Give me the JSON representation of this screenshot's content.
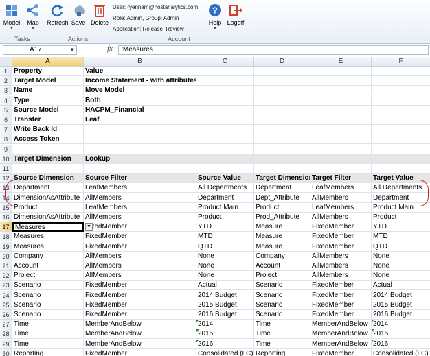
{
  "ribbon": {
    "groups": [
      {
        "label": "Tasks",
        "buttons": [
          {
            "label": "Model",
            "icon": "model-icon"
          },
          {
            "label": "Map",
            "icon": "map-icon"
          }
        ]
      },
      {
        "label": "Actions",
        "buttons": [
          {
            "label": "Refresh",
            "icon": "refresh-icon"
          },
          {
            "label": "Save",
            "icon": "save-icon"
          },
          {
            "label": "Delete",
            "icon": "delete-icon"
          }
        ]
      },
      {
        "label": "Account",
        "buttons": [
          {
            "label": "Help",
            "icon": "help-icon"
          },
          {
            "label": "Logoff",
            "icon": "logoff-icon"
          }
        ]
      }
    ],
    "user": "User: ryennam@hostanalytics.com",
    "role": "Role: Admin, Group: Admin",
    "application": "Application: Release_Review"
  },
  "formula_bar": {
    "name_box": "A17",
    "fx": "fx",
    "content": "'Measures"
  },
  "columns": [
    "A",
    "B",
    "C",
    "D",
    "E",
    "F"
  ],
  "rows": [
    {
      "num": "1",
      "cells": [
        "Property",
        "Value",
        "",
        "",
        "",
        ""
      ],
      "bold": true
    },
    {
      "num": "2",
      "cells": [
        "Target Model",
        "Income Statement - with attributes",
        "",
        "",
        "",
        ""
      ],
      "bold": true
    },
    {
      "num": "3",
      "cells": [
        "Name",
        "Move Model",
        "",
        "",
        "",
        ""
      ],
      "bold": true
    },
    {
      "num": "4",
      "cells": [
        "Type",
        "Both",
        "",
        "",
        "",
        ""
      ],
      "bold": true
    },
    {
      "num": "5",
      "cells": [
        "Source Model",
        "HACPM_Financial",
        "",
        "",
        "",
        ""
      ],
      "bold": true
    },
    {
      "num": "6",
      "cells": [
        "Transfer",
        "Leaf",
        "",
        "",
        "",
        ""
      ],
      "bold": true
    },
    {
      "num": "7",
      "cells": [
        "Write Back Id",
        "",
        "",
        "",
        "",
        ""
      ],
      "bold": true
    },
    {
      "num": "8",
      "cells": [
        "Access Token",
        "",
        "",
        "",
        "",
        ""
      ],
      "bold": true
    },
    {
      "num": "9",
      "cells": [
        "",
        "",
        "",
        "",
        "",
        ""
      ]
    },
    {
      "num": "10",
      "cells": [
        "Target Dimension",
        "Lookup",
        "",
        "",
        "",
        ""
      ],
      "bold": true,
      "shade": true
    },
    {
      "num": "11",
      "cells": [
        "",
        "",
        "",
        "",
        "",
        ""
      ]
    },
    {
      "num": "12",
      "cells": [
        "Source Dimension",
        "Source Filter",
        "Source Value",
        "Target Dimension",
        "Target Filter",
        "Target Value"
      ],
      "bold": true,
      "shade": true
    },
    {
      "num": "13",
      "cells": [
        "Department",
        "LeafMembers",
        "All Departments",
        "Department",
        "LeafMembers",
        "All Departments"
      ]
    },
    {
      "num": "14",
      "cells": [
        "DimensionAsAttribute",
        "AllMembers",
        "Department",
        "Dept_Attribute",
        "AllMembers",
        "Department"
      ]
    },
    {
      "num": "15",
      "cells": [
        "Product",
        "LeafMembers",
        "Product Main",
        "Product",
        "LeafMembers",
        "Product Main"
      ]
    },
    {
      "num": "16",
      "cells": [
        "DimensionAsAttribute",
        "AllMembers",
        "Product",
        "Prod_Attribute",
        "AllMembers",
        "Product"
      ]
    },
    {
      "num": "17",
      "cells": [
        "Measures",
        "FixedMember",
        "YTD",
        "Measure",
        "FixedMember",
        "YTD"
      ]
    },
    {
      "num": "18",
      "cells": [
        "Measures",
        "FixedMember",
        "MTD",
        "Measure",
        "FixedMember",
        "MTD"
      ]
    },
    {
      "num": "19",
      "cells": [
        "Measures",
        "FixedMember",
        "QTD",
        "Measure",
        "FixedMember",
        "QTD"
      ]
    },
    {
      "num": "20",
      "cells": [
        "Company",
        "AllMembers",
        "None",
        "Company",
        "AllMembers",
        "None"
      ]
    },
    {
      "num": "21",
      "cells": [
        "Account",
        "AllMembers",
        "None",
        "Account",
        "AllMembers",
        "None"
      ]
    },
    {
      "num": "22",
      "cells": [
        "Project",
        "AllMembers",
        "None",
        "Project",
        "AllMembers",
        "None"
      ]
    },
    {
      "num": "23",
      "cells": [
        "Scenario",
        "FixedMember",
        "Actual",
        "Scenario",
        "FixedMember",
        "Actual"
      ]
    },
    {
      "num": "24",
      "cells": [
        "Scenario",
        "FixedMember",
        "2014 Budget",
        "Scenario",
        "FixedMember",
        "2014 Budget"
      ]
    },
    {
      "num": "25",
      "cells": [
        "Scenario",
        "FixedMember",
        "2015 Budget",
        "Scenario",
        "FixedMember",
        "2015 Budget"
      ]
    },
    {
      "num": "26",
      "cells": [
        "Scenario",
        "FixedMember",
        "2016 Budget",
        "Scenario",
        "FixedMember",
        "2016 Budget"
      ]
    },
    {
      "num": "27",
      "cells": [
        "Time",
        "MemberAndBelow",
        "2014",
        "Time",
        "MemberAndBelow",
        "2014"
      ],
      "tri": [
        2,
        5
      ]
    },
    {
      "num": "28",
      "cells": [
        "Time",
        "MemberAndBelow",
        "2015",
        "Time",
        "MemberAndBelow",
        "2015"
      ],
      "tri": [
        2,
        5
      ]
    },
    {
      "num": "29",
      "cells": [
        "Time",
        "MemberAndBelow",
        "2016",
        "Time",
        "MemberAndBelow",
        "2016"
      ],
      "tri": [
        2,
        5
      ]
    },
    {
      "num": "30",
      "cells": [
        "Reporting",
        "FixedMember",
        "Consolidated (LC)",
        "Reporting",
        "FixedMember",
        "Consolidated (LC)"
      ]
    }
  ],
  "active_cell": {
    "row": "17",
    "col": "A"
  },
  "colors": {
    "annotation": "#c0262c",
    "selection": "#f1cf79",
    "header_shade": "#e6e6e6"
  }
}
